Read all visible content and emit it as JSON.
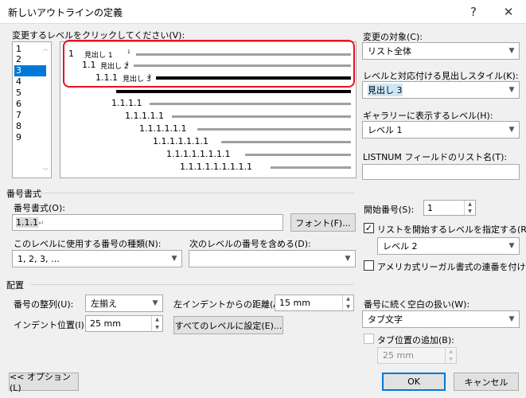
{
  "window": {
    "title": "新しいアウトラインの定義",
    "help_label": "?",
    "close_label": "✕"
  },
  "level_list": {
    "label": "変更するレベルをクリックしてください(V):",
    "items": [
      "1",
      "2",
      "3",
      "4",
      "5",
      "6",
      "7",
      "8",
      "9"
    ],
    "selected": "3"
  },
  "preview": {
    "rows": [
      {
        "number": "1",
        "heading": "見出し 1",
        "sub": "1"
      },
      {
        "number": "1.1",
        "heading": "見出し 2",
        "sub": "2"
      },
      {
        "number": "1.1.1",
        "heading": "見出し 3",
        "sub": "3"
      },
      {
        "number": "1.1.1.1"
      },
      {
        "number": "1.1.1.1.1"
      },
      {
        "number": "1.1.1.1.1.1"
      },
      {
        "number": "1.1.1.1.1.1.1"
      },
      {
        "number": "1.1.1.1.1.1.1.1"
      },
      {
        "number": "1.1.1.1.1.1.1.1.1"
      }
    ],
    "highlight_color": "#e81123"
  },
  "apply_to": {
    "label": "変更の対象(C):",
    "value": "リスト全体"
  },
  "link_style": {
    "label": "レベルと対応付ける見出しスタイル(K):",
    "value": "見出し 3"
  },
  "gallery_level": {
    "label": "ギャラリーに表示するレベル(H):",
    "value": "レベル 1"
  },
  "listnum": {
    "label": "LISTNUM フィールドのリスト名(T):",
    "value": ""
  },
  "number_format_section": {
    "title": "番号書式",
    "format_label": "番号書式(O):",
    "format_value": "1.1.1",
    "format_mark": "↵",
    "font_button": "フォント(F)...",
    "style_label": "このレベルに使用する番号の種類(N):",
    "style_value": "1, 2, 3, …",
    "include_label": "次のレベルの番号を含める(D):",
    "include_value": ""
  },
  "start_at": {
    "label": "開始番号(S):",
    "value": "1"
  },
  "restart": {
    "label": "リストを開始するレベルを指定する(R):",
    "checked": true,
    "value": "レベル 2"
  },
  "legal": {
    "label": "アメリカ式リーガル書式の連番を付ける(G)",
    "checked": false
  },
  "position_section": {
    "title": "配置",
    "alignment_label": "番号の整列(U):",
    "alignment_value": "左揃え",
    "aligned_at_label": "左インデントからの距離(A):",
    "aligned_at_value": "15 mm",
    "indent_label": "インデント位置(I):",
    "indent_value": "25 mm",
    "set_all_button": "すべてのレベルに設定(E)..."
  },
  "follow": {
    "label": "番号に続く空白の扱い(W):",
    "value": "タブ文字",
    "tab_add_label": "タブ位置の追加(B):",
    "tab_add_checked": false,
    "tab_value": "25 mm"
  },
  "footer": {
    "options_button": "<< オプション(L)",
    "ok_button": "OK",
    "cancel_button": "キャンセル"
  }
}
